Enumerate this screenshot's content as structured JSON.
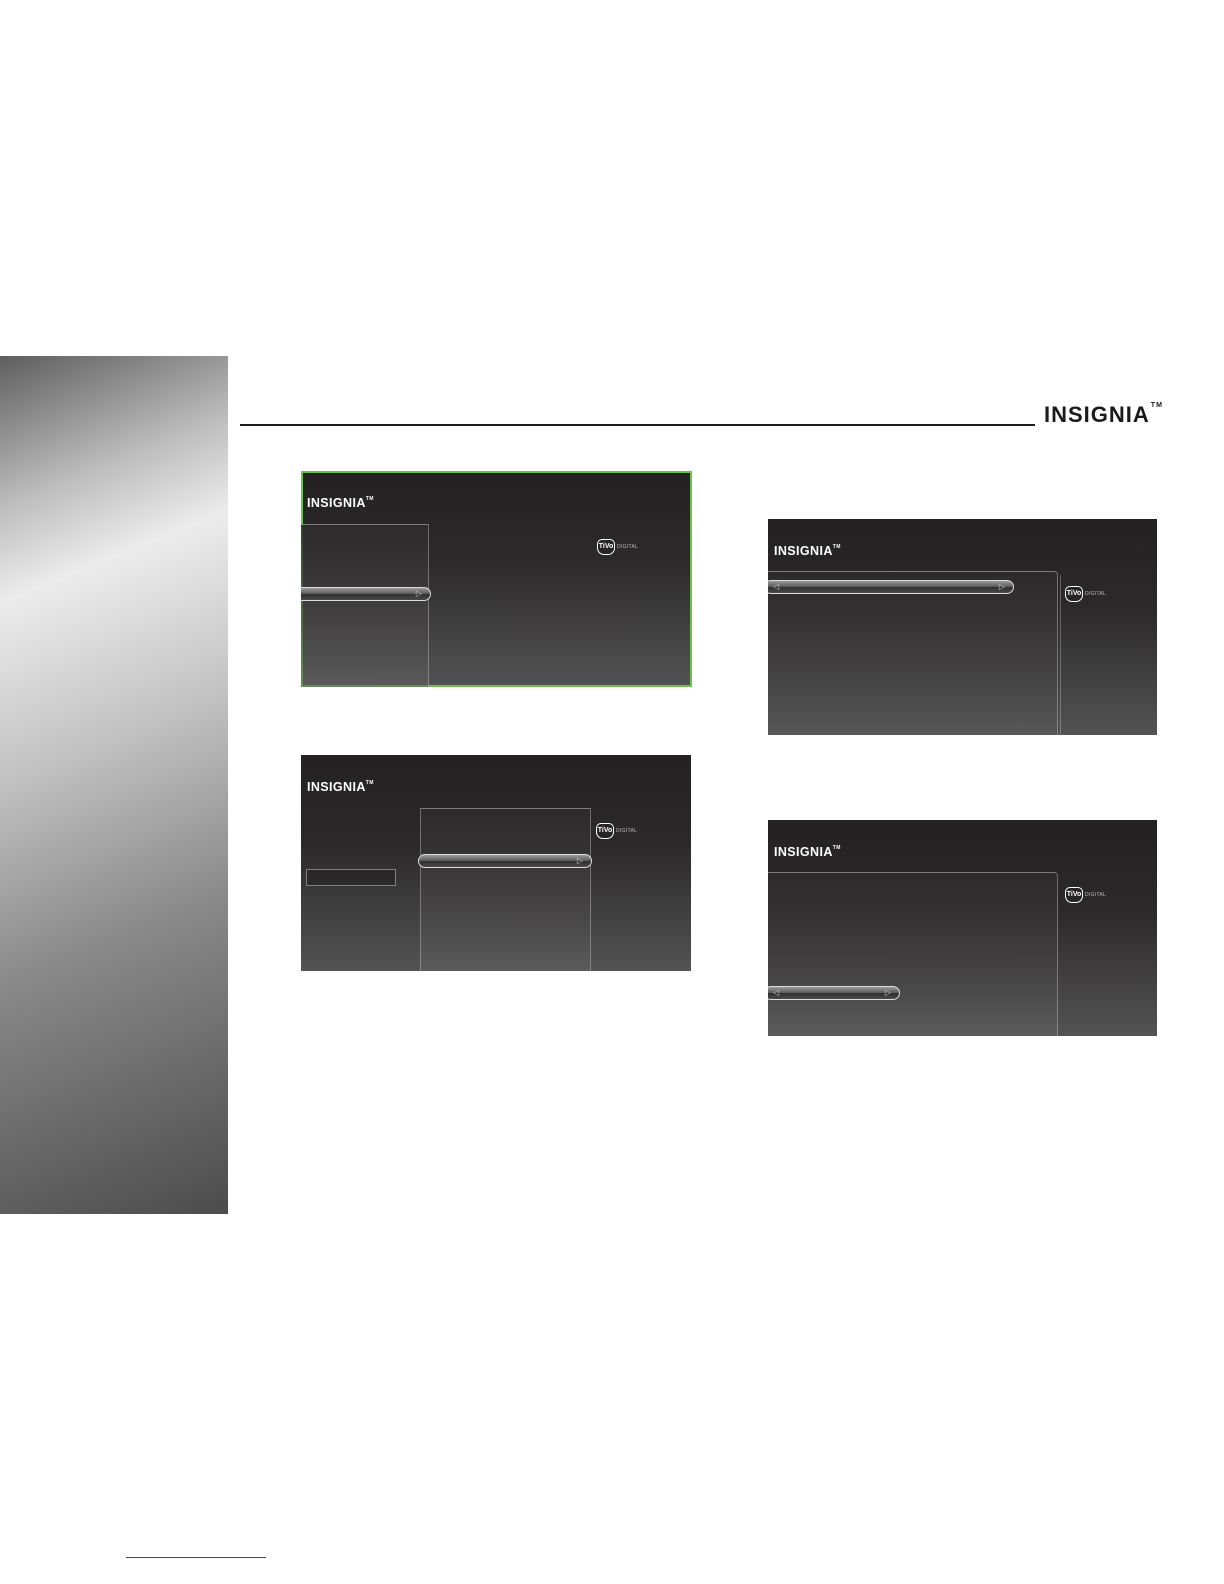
{
  "header": {
    "brand": "INSIGNIA",
    "brand_tm": "TM"
  },
  "screens": {
    "common": {
      "logo": "INSIGNIA",
      "logo_tm": "TM",
      "tivo_badge": "TiVo",
      "tivo_word": "DIGITAL",
      "arrow_right": "▷",
      "arrow_left": "◁"
    }
  },
  "colors": {
    "frame_highlight": "#6ac24a",
    "screen_top": "#232122",
    "screen_bottom": "#545353",
    "link_underline": "#2a40c8"
  },
  "icons": [
    "insignia-logo",
    "tivo-logo",
    "right-arrow-icon",
    "left-arrow-icon"
  ]
}
